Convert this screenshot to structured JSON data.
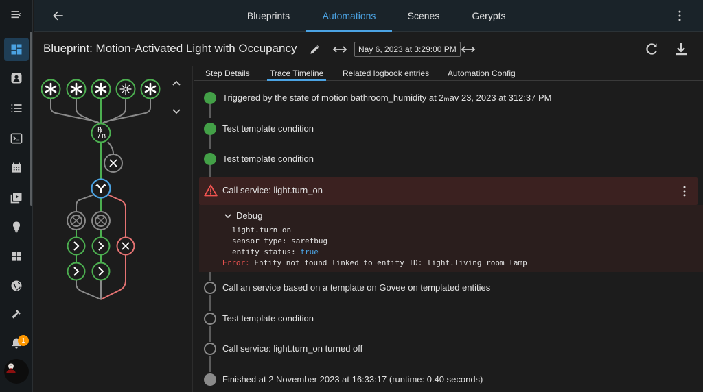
{
  "sidebar": {
    "items": [
      {
        "icon": "dashboard-icon",
        "active": true
      },
      {
        "icon": "person-badge-icon"
      },
      {
        "icon": "list-icon"
      },
      {
        "icon": "terminal-icon"
      },
      {
        "icon": "calendar-grid-icon"
      },
      {
        "icon": "media-icon"
      },
      {
        "icon": "lightbulb-icon"
      },
      {
        "icon": "widgets-icon"
      },
      {
        "icon": "globe-icon"
      },
      {
        "icon": "hammer-icon"
      }
    ],
    "notifications_count": "1"
  },
  "header": {
    "tabs": [
      {
        "label": "Blueprints"
      },
      {
        "label": "Automations",
        "active": true
      },
      {
        "label": "Scenes"
      },
      {
        "label": "Gerypts"
      }
    ]
  },
  "titlebar": {
    "title": "Blueprint: Motion-Activated Light with Occupancy",
    "date": "Nay 6, 2023 at 3:29:00 PM"
  },
  "subtabs": [
    {
      "label": "Step Details"
    },
    {
      "label": "Trace Timeline",
      "active": true
    },
    {
      "label": "Related logbook entries"
    },
    {
      "label": "Automation Config"
    }
  ],
  "timeline": {
    "items": [
      {
        "status": "success",
        "text": "Triggered by the state of motion bathroom_humidity at 2ₘav 23, 2023 at 312:37 PM"
      },
      {
        "status": "success",
        "text": "Test template condition"
      },
      {
        "status": "success",
        "text": "Test template condition"
      },
      {
        "status": "error",
        "text": "Call service: light.turn_on"
      },
      {
        "status": "pending",
        "text": "Call an service based on a template on Govee on templated entities"
      },
      {
        "status": "pending",
        "text": "Test template condition"
      },
      {
        "status": "pending",
        "text": "Call service: light.turn_on turned off"
      },
      {
        "status": "finished",
        "text": "Finished at 2 November 2023 at 16:33:17 (runtime: 0.40 seconds)"
      }
    ],
    "debug": {
      "label": "Debug",
      "service": "light.turn_on",
      "sensor_key": "sensor_type:",
      "sensor_value": "saretbug",
      "entity_key": "entity_status:",
      "entity_value": "true",
      "error_label": "Error:",
      "error_text": "Entity not found linked to entity ID: light.living_room_lamp"
    }
  },
  "graph": {
    "split_node_label": "R/B",
    "colors": {
      "active_path": "#4caf50",
      "error_path": "#e57373",
      "inactive_path": "#8a8a8a",
      "current_node": "#4ba3e3"
    }
  },
  "colors": {
    "accent": "#4ba3e3",
    "success": "#43a047",
    "error": "#ef5350",
    "badge": "#ff9800"
  }
}
